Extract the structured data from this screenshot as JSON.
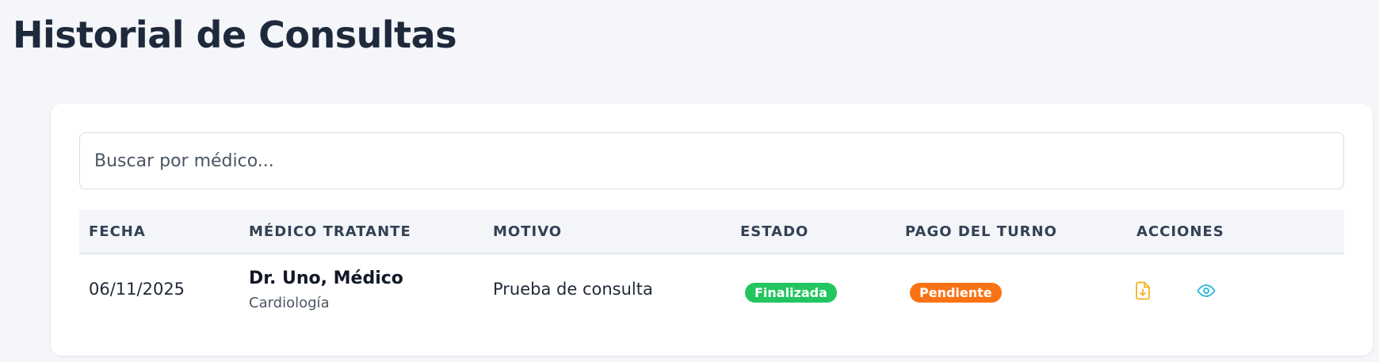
{
  "page": {
    "title": "Historial de Consultas"
  },
  "search": {
    "placeholder": "Buscar por médico...",
    "value": ""
  },
  "table": {
    "headers": {
      "fecha": "FECHA",
      "medico": "MÉDICO TRATANTE",
      "motivo": "MOTIVO",
      "estado": "ESTADO",
      "pago": "PAGO DEL TURNO",
      "acciones": "ACCIONES"
    },
    "rows": [
      {
        "fecha": "06/11/2025",
        "medico_nombre": "Dr. Uno, Médico",
        "medico_especialidad": "Cardiología",
        "motivo": "Prueba de consulta",
        "estado": "Finalizada",
        "pago": "Pendiente",
        "actions": [
          "file-download-icon",
          "eye-icon"
        ]
      }
    ]
  },
  "colors": {
    "estado_finalizada": "#22c55e",
    "pago_pendiente": "#f97316",
    "download_icon": "#f5b324",
    "view_icon": "#22b8d8"
  }
}
